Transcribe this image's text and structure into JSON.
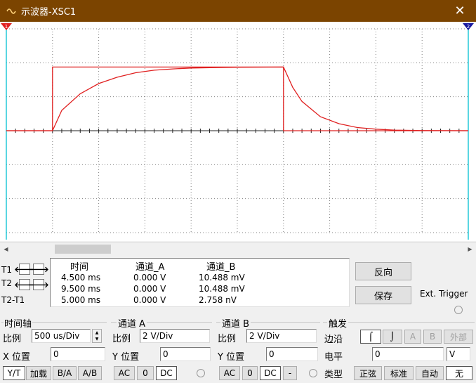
{
  "window": {
    "title": "示波器-XSC1",
    "close_glyph": "✕"
  },
  "screen": {
    "background": "#ffffff",
    "trace_color": "#e02020",
    "grid_color": "#808080",
    "cursor1_color": "#e02020",
    "cursor2_color": "#1a1aa0",
    "cursor1_label": "1",
    "cursor2_label": "2"
  },
  "chart_data": {
    "type": "line",
    "title": "",
    "xlabel": "",
    "ylabel": "",
    "x_per_div_ms": 0.5,
    "y_per_div_V": 2,
    "xlim_ms": [
      0,
      5
    ],
    "ylim_V": [
      -8,
      8
    ],
    "series": [
      {
        "points": [
          [
            0,
            0
          ],
          [
            0.5,
            0
          ],
          [
            0.5,
            5
          ],
          [
            1.1,
            5
          ],
          [
            2.0,
            5
          ],
          [
            2.5,
            5
          ],
          [
            3.0,
            5
          ],
          [
            3.0,
            0
          ],
          [
            5.0,
            0
          ]
        ]
      },
      {
        "points": [
          [
            0,
            0
          ],
          [
            0.5,
            0
          ],
          [
            0.6,
            1.6
          ],
          [
            0.8,
            2.9
          ],
          [
            1.0,
            3.7
          ],
          [
            1.2,
            4.2
          ],
          [
            1.4,
            4.55
          ],
          [
            1.6,
            4.75
          ],
          [
            1.8,
            4.85
          ],
          [
            2.0,
            4.92
          ],
          [
            2.2,
            4.95
          ],
          [
            2.5,
            4.98
          ],
          [
            3.0,
            5.0
          ],
          [
            3.1,
            3.4
          ],
          [
            3.2,
            2.3
          ],
          [
            3.4,
            1.1
          ],
          [
            3.6,
            0.55
          ],
          [
            3.8,
            0.25
          ],
          [
            4.0,
            0.12
          ],
          [
            4.2,
            0.05
          ],
          [
            4.5,
            0.01
          ],
          [
            5.0,
            0
          ]
        ]
      }
    ]
  },
  "measurements": {
    "headers": {
      "time": "时间",
      "chA": "通道_A",
      "chB": "通道_B"
    },
    "rows": [
      {
        "label": "T1",
        "time": "4.500 ms",
        "chA": "0.000 V",
        "chB": "10.488 mV"
      },
      {
        "label": "T2",
        "time": "9.500 ms",
        "chA": "0.000 V",
        "chB": "10.488 mV"
      },
      {
        "label": "T2-T1",
        "time": "5.000 ms",
        "chA": "0.000 V",
        "chB": "2.758 nV"
      }
    ]
  },
  "actions": {
    "reverse": "反向",
    "save": "保存",
    "ext_trigger": "Ext. Trigger"
  },
  "timebase": {
    "title": "时间轴",
    "scale_label": "比例",
    "scale_value": "500 us/Div",
    "xpos_label": "X 位置",
    "xpos_value": "0",
    "modes": [
      "Y/T",
      "加载",
      "B/A",
      "A/B"
    ]
  },
  "channel_a": {
    "title": "通道 A",
    "scale_label": "比例",
    "scale_value": "2  V/Div",
    "ypos_label": "Y 位置",
    "ypos_value": "0",
    "coupling": [
      "AC",
      "0",
      "DC"
    ]
  },
  "channel_b": {
    "title": "通道 B",
    "scale_label": "比例",
    "scale_value": "2  V/Div",
    "ypos_label": "Y 位置",
    "ypos_value": "0",
    "coupling": [
      "AC",
      "0",
      "DC",
      "-"
    ]
  },
  "trigger": {
    "title": "触发",
    "edge_label": "边沿",
    "edge_buttons": [
      "⌠",
      "⌡",
      "A",
      "B",
      "外部"
    ],
    "level_label": "电平",
    "level_value": "0",
    "level_unit": "V",
    "type_label": "类型",
    "type_buttons": [
      "正弦",
      "标准",
      "自动",
      "无"
    ]
  }
}
